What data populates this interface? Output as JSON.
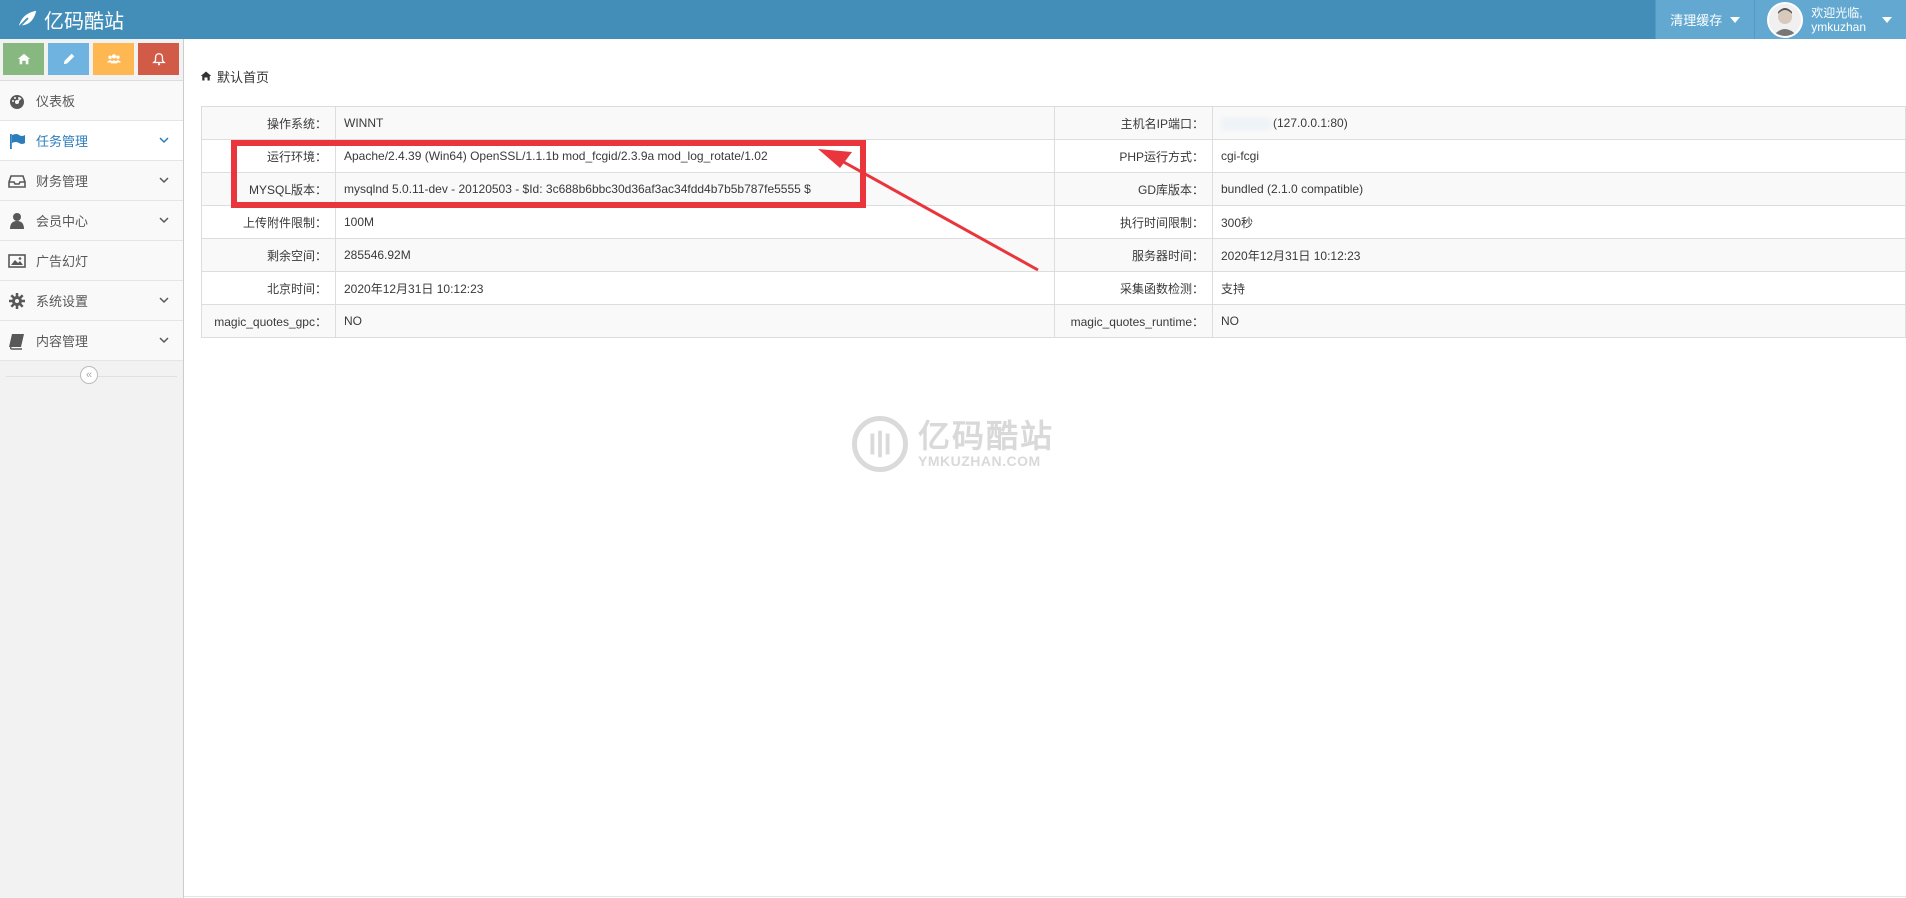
{
  "header": {
    "brand": "亿码酷站",
    "clear_cache": "清理缓存",
    "welcome": "欢迎光临,",
    "username": "ymkuzhan",
    "bar_color": "#438eb9"
  },
  "shortcuts": [
    {
      "icon": "home-icon",
      "color": "#87b87f"
    },
    {
      "icon": "pencil-icon",
      "color": "#6fb3e0"
    },
    {
      "icon": "users-icon",
      "color": "#ffb752"
    },
    {
      "icon": "bell-icon",
      "color": "#d15b47"
    }
  ],
  "sidebar": {
    "items": [
      {
        "label": "仪表板",
        "icon": "dashboard-icon"
      },
      {
        "label": "任务管理",
        "icon": "flag-icon"
      },
      {
        "label": "财务管理",
        "icon": "inbox-icon"
      },
      {
        "label": "会员中心",
        "icon": "user-icon"
      },
      {
        "label": "广告幻灯",
        "icon": "picture-icon"
      },
      {
        "label": "系统设置",
        "icon": "gear-icon"
      },
      {
        "label": "内容管理",
        "icon": "book-icon"
      }
    ],
    "active_color": "#2b7dbc"
  },
  "breadcrumb": {
    "icon": "home-icon",
    "label": "默认首页"
  },
  "info": {
    "rows": [
      {
        "l1": "操作系统：",
        "v1": "WINNT",
        "l2": "主机名IP端口：",
        "v2": "(127.0.0.1:80)"
      },
      {
        "l1": "运行环境：",
        "v1": "Apache/2.4.39 (Win64) OpenSSL/1.1.1b mod_fcgid/2.3.9a mod_log_rotate/1.02",
        "l2": "PHP运行方式：",
        "v2": "cgi-fcgi"
      },
      {
        "l1": "MYSQL版本：",
        "v1": "mysqlnd 5.0.11-dev - 20120503 - $Id: 3c688b6bbc30d36af3ac34fdd4b7b5b787fe5555 $",
        "l2": "GD库版本：",
        "v2": "bundled (2.1.0 compatible)"
      },
      {
        "l1": "上传附件限制：",
        "v1": "100M",
        "l2": "执行时间限制：",
        "v2": "300秒"
      },
      {
        "l1": "剩余空间：",
        "v1": "285546.92M",
        "l2": "服务器时间：",
        "v2": "2020年12月31日 10:12:23"
      },
      {
        "l1": "北京时间：",
        "v1": "2020年12月31日 10:12:23",
        "l2": "采集函数检测：",
        "v2": "支持"
      },
      {
        "l1": "magic_quotes_gpc：",
        "v1": "NO",
        "l2": "magic_quotes_runtime：",
        "v2": "NO"
      }
    ]
  },
  "annotation": {
    "color": "#e8363c"
  },
  "watermark": {
    "title": "亿码酷站",
    "subtitle": "YMKUZHAN.COM"
  }
}
